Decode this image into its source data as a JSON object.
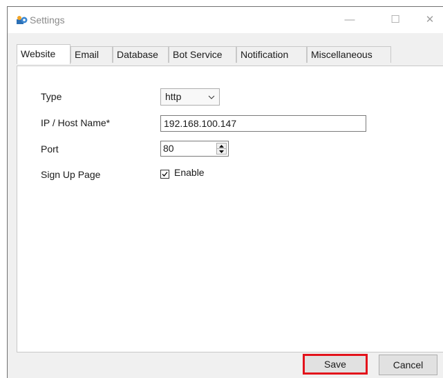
{
  "window": {
    "title": "Settings",
    "controls": {
      "minimize": "—",
      "maximize": "☐",
      "close": "✕"
    }
  },
  "tabs": [
    {
      "label": "Website",
      "active": true
    },
    {
      "label": "Email",
      "active": false
    },
    {
      "label": "Database",
      "active": false
    },
    {
      "label": "Bot Service",
      "active": false
    },
    {
      "label": "Notification",
      "active": false
    },
    {
      "label": "Miscellaneous",
      "active": false
    }
  ],
  "form": {
    "type_label": "Type",
    "type_value": "http",
    "host_label": "IP / Host Name*",
    "host_value": "192.168.100.147",
    "port_label": "Port",
    "port_value": "80",
    "signup_label": "Sign Up Page",
    "signup_checkbox_label": "Enable",
    "signup_checked": true
  },
  "buttons": {
    "save": "Save",
    "cancel": "Cancel"
  },
  "colors": {
    "highlight": "#e3121b"
  },
  "icons": {
    "app": "settings-app-icon",
    "dropdown": "chevron-down-icon",
    "check": "checkmark-icon"
  }
}
